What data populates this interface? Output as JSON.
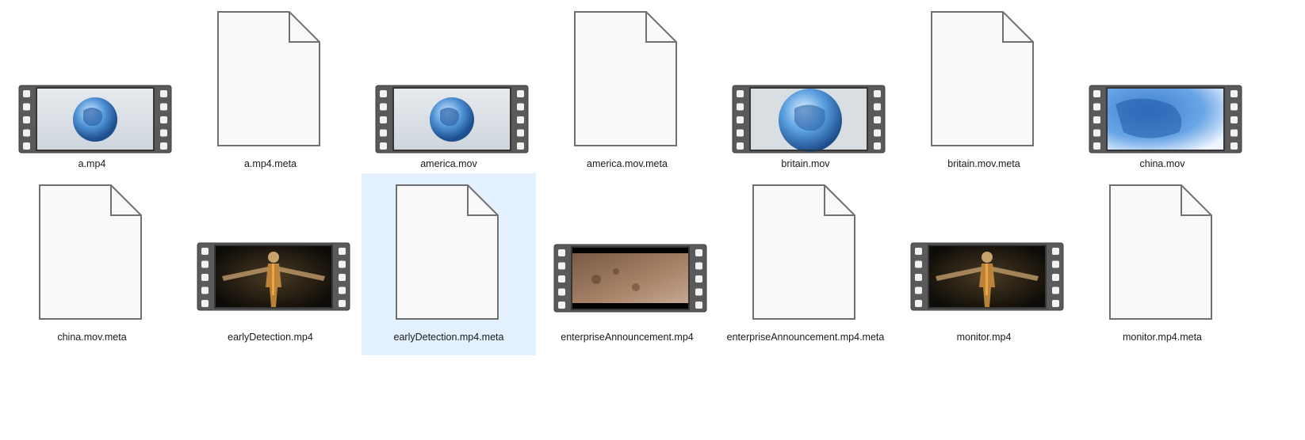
{
  "files": [
    {
      "name": "a.mp4",
      "kind": "video",
      "thumbnail": "globe-small-icon"
    },
    {
      "name": "a.mp4.meta",
      "kind": "document"
    },
    {
      "name": "america.mov",
      "kind": "video",
      "thumbnail": "globe-small-icon"
    },
    {
      "name": "america.mov.meta",
      "kind": "document"
    },
    {
      "name": "britain.mov",
      "kind": "video",
      "thumbnail": "globe-large-icon"
    },
    {
      "name": "britain.mov.meta",
      "kind": "document"
    },
    {
      "name": "china.mov",
      "kind": "video",
      "thumbnail": "map-closeup-icon"
    },
    {
      "name": "china.mov.meta",
      "kind": "document"
    },
    {
      "name": "earlyDetection.mp4",
      "kind": "video",
      "thumbnail": "human-body-icon"
    },
    {
      "name": "earlyDetection.mp4.meta",
      "kind": "document",
      "selected": true
    },
    {
      "name": "enterpriseAnnouncement.mp4",
      "kind": "video",
      "thumbnail": "soil-closeup-icon"
    },
    {
      "name": "enterpriseAnnouncement.mp4.meta",
      "kind": "document"
    },
    {
      "name": "monitor.mp4",
      "kind": "video",
      "thumbnail": "human-body-icon"
    },
    {
      "name": "monitor.mp4.meta",
      "kind": "document"
    }
  ],
  "colors": {
    "selection": "#e3f0fd",
    "film_strip": "#5a5a5a",
    "page_stroke": "#707070",
    "page_fill": "#f9f9f9"
  }
}
